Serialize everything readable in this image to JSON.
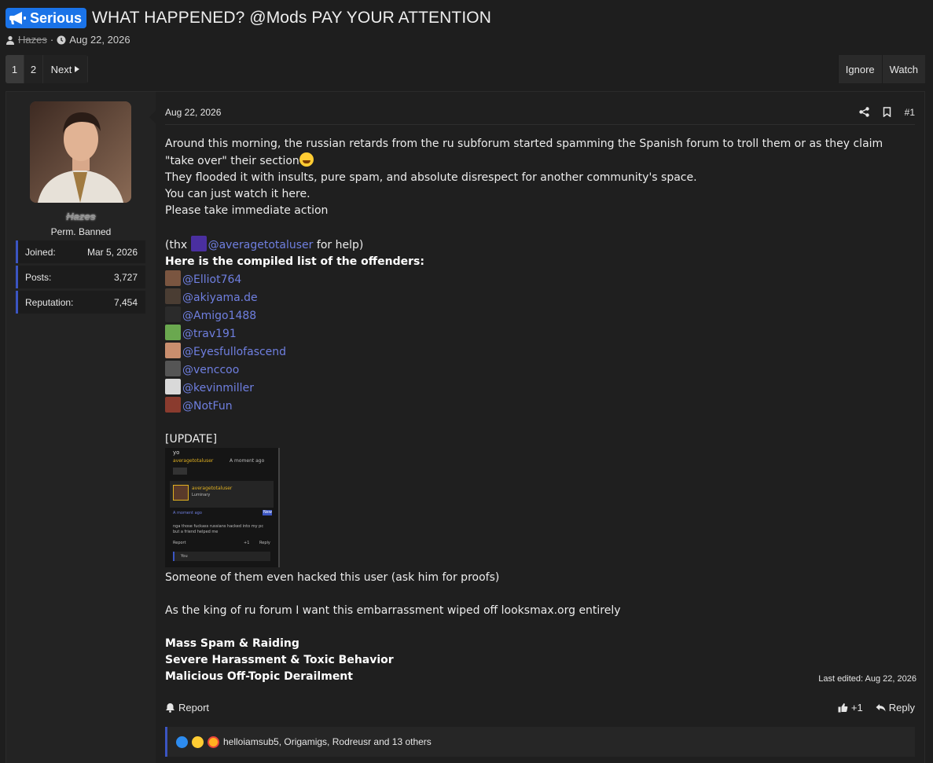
{
  "thread": {
    "prefix": "Serious",
    "title": "WHAT HAPPENED? @Mods PAY YOUR ATTENTION",
    "author": "Hazes",
    "date": "Aug 22, 2026"
  },
  "pagination": {
    "pages": [
      "1",
      "2"
    ],
    "current": "1",
    "next_label": "Next"
  },
  "actions": {
    "ignore": "Ignore",
    "watch": "Watch"
  },
  "user": {
    "name": "Hazes",
    "title": "Perm. Banned",
    "stats": [
      {
        "label": "Joined:",
        "value": "Mar 5, 2026"
      },
      {
        "label": "Posts:",
        "value": "3,727"
      },
      {
        "label": "Reputation:",
        "value": "7,454"
      }
    ]
  },
  "post": {
    "date": "Aug 22, 2026",
    "number": "#1",
    "intro": "Around this morning, the russian retards from the ru subforum started spamming the Spanish forum to troll them or as they claim \"take over\" their section",
    "line2": "They flooded it with insults, pure spam, and absolute disrespect for another community's space.",
    "line3": "You can just watch it here.",
    "line4": "Please take immediate action",
    "thanks_prefix": "(thx ",
    "thanks_mention": "@averagetotaluser",
    "thanks_suffix": " for help)",
    "list_heading": "Here is the compiled list of the offenders:",
    "offenders": [
      "@Elliot764",
      "@akiyama.de",
      "@Amigo1488",
      "@trav191",
      "@Eyesfullofascend",
      "@venccoo",
      "@kevinmiller",
      "@NotFun"
    ],
    "update_label": "[UPDATE]",
    "screenshot": {
      "t1": "yo",
      "t2": "averagetotaluser",
      "t3": "A moment ago",
      "t4": "averagetotaluser",
      "t5": "Luminary",
      "t6": "A moment ago",
      "t7": "New",
      "t8": "nga those fuckass russians hacked into my pc",
      "t9": "but a friend helped me",
      "t10": "Report",
      "t11": "+1",
      "t12": "Reply",
      "t13": "You"
    },
    "after_update": "Someone of them even hacked this user (ask him for proofs)",
    "king_line": "As the king of ru forum I want this embarrassment wiped off looksmax.org entirely",
    "reasons": [
      "Mass Spam & Raiding",
      "Severe Harassment & Toxic Behavior",
      "Malicious Off-Topic Derailment"
    ],
    "last_edited": "Last edited: Aug 22, 2026",
    "report_label": "Report",
    "like_count": "+1",
    "reply_label": "Reply",
    "reactions_text": "helloiamsub5, Origamigs, Rodreusr and 13 others"
  },
  "colors": {
    "prefix": "#1a73e8",
    "accent": "#3b55c2",
    "mention": "#6f7fe0"
  },
  "icons": [
    "megaphone-icon",
    "user-icon",
    "clock-icon",
    "chevron-right-icon",
    "share-icon",
    "bookmark-icon",
    "bell-icon",
    "thumbs-up-icon",
    "reply-icon"
  ]
}
